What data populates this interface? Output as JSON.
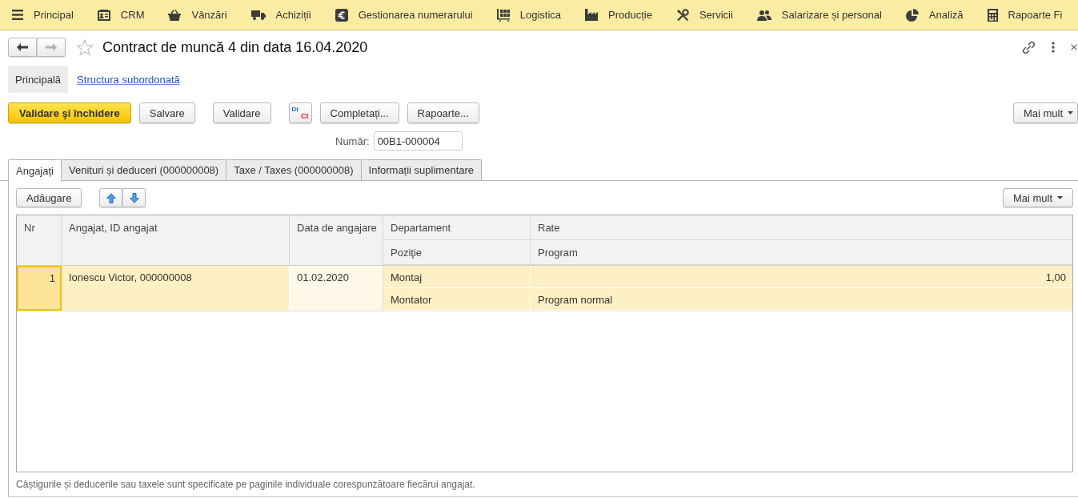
{
  "top_menu": [
    "Principal",
    "CRM",
    "Vânzări",
    "Achiziții",
    "Gestionarea numerarului",
    "Logistica",
    "Producție",
    "Servicii",
    "Salarizare și personal",
    "Analiză",
    "Rapoarte Fi"
  ],
  "window": {
    "title": "Contract de muncă 4 din data 16.04.2020",
    "favorite": false,
    "navigation": [
      {
        "kind": "back",
        "disabled": false
      },
      {
        "kind": "forward",
        "disabled": true
      }
    ]
  },
  "sections": [
    {
      "label": "Principală",
      "selected": true
    },
    {
      "label": "Structura subordonată",
      "selected": false
    }
  ],
  "toolbar": {
    "groups": [
      [
        {
          "kind": "primary",
          "label": "Validare şi închidere"
        },
        {
          "kind": "plain",
          "label": "Salvare"
        }
      ],
      [
        {
          "kind": "plain",
          "label": "Validare"
        }
      ],
      [
        {
          "kind": "posting",
          "top": "Dt",
          "bottom": "Ct"
        },
        {
          "kind": "plain",
          "label": "Completați..."
        },
        {
          "kind": "plain",
          "label": "Rapoarte..."
        }
      ]
    ],
    "more": "Mai mult"
  },
  "number": {
    "label": "Număr:",
    "value": "00B1-000004"
  },
  "tabs": [
    {
      "label": "Angajați",
      "selected": true
    },
    {
      "label": "Venituri și deduceri (000000008)",
      "selected": false
    },
    {
      "label": "Taxe / Taxes (000000008)",
      "selected": false
    },
    {
      "label": "Informații suplimentare",
      "selected": false
    }
  ],
  "employees": {
    "add": "Adăugare",
    "more": "Mai mult",
    "columns": [
      {
        "label": "Nr"
      },
      {
        "label": "Angajat, ID angajat"
      },
      {
        "label": "Data de angajare"
      },
      {
        "label": "Departament",
        "sub_label": "Poziţie"
      },
      {
        "label": "Rate",
        "sub_label": "Program"
      }
    ],
    "rows": [
      {
        "selected": true,
        "nr": "1",
        "employee": "Ionescu Victor, 000000008",
        "hire_date": "01.02.2020",
        "department": "Montaj",
        "rate": "1,00",
        "position": "Montator",
        "schedule": "Program normal"
      }
    ]
  },
  "note": "Câștigurile și deducerile sau taxele sunt specificate pe paginile individuale corespunzătoare fiecărui angajat."
}
